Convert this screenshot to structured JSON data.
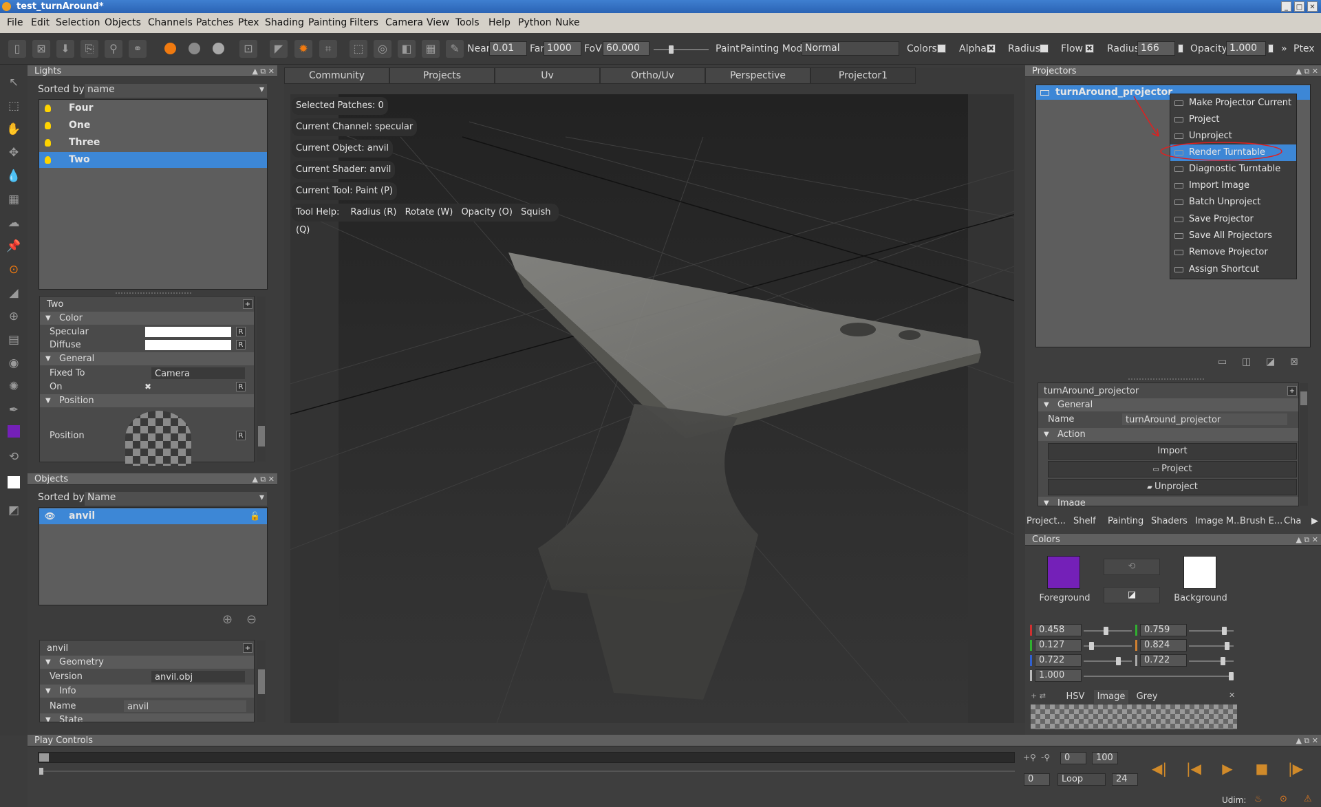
{
  "window": {
    "title": "test_turnAround*"
  },
  "menubar": [
    "File",
    "Edit",
    "Selection",
    "Objects",
    "Channels",
    "Patches",
    "Ptex",
    "Shading",
    "Painting",
    "Filters",
    "Camera",
    "View",
    "Tools",
    "Help",
    "Python",
    "Nuke"
  ],
  "toolbar": {
    "near_label": "Near",
    "near_value": "0.01",
    "far_label": "Far",
    "far_value": "1000",
    "fov_label": "FoV",
    "fov_value": "60.000",
    "paint_label": "Paint",
    "painting_mode_label": "Painting Mode",
    "painting_mode_value": "Normal",
    "colors_label": "Colors",
    "alpha_label": "Alpha",
    "radius_label": "Radius",
    "flow_label": "Flow",
    "radius2_label": "Radius",
    "radius2_value": "166",
    "opacity_label": "Opacity",
    "opacity_value": "1.000",
    "ptex_label": "Ptex"
  },
  "lights": {
    "panel_title": "Lights",
    "sorted_by_label": "Sorted by",
    "sorted_by_value": "name",
    "items": [
      "Four",
      "One",
      "Three",
      "Two"
    ],
    "selected": "Two",
    "props": {
      "title": "Two",
      "color_section": "Color",
      "specular_label": "Specular",
      "diffuse_label": "Diffuse",
      "general_section": "General",
      "fixed_to_label": "Fixed To",
      "fixed_to_value": "Camera",
      "on_label": "On",
      "position_section": "Position",
      "position_label": "Position",
      "reset": "R"
    }
  },
  "objects": {
    "panel_title": "Objects",
    "sorted_by_label": "Sorted by",
    "sorted_by_value": "Name",
    "items": [
      "anvil"
    ],
    "props": {
      "title": "anvil",
      "geometry_section": "Geometry",
      "version_label": "Version",
      "version_value": "anvil.obj",
      "info_section": "Info",
      "name_label": "Name",
      "name_value": "anvil",
      "state_section": "State"
    }
  },
  "viewport": {
    "tabs": [
      "Community",
      "Projects",
      "Uv",
      "Ortho/Uv",
      "Perspective",
      "Projector1"
    ],
    "active_tab": "Projector1",
    "info": [
      "Selected Patches: 0",
      "Current Channel: specular",
      "Current Object: anvil",
      "Current Shader: anvil",
      "Current Tool: Paint (P)"
    ],
    "tool_help": {
      "label": "Tool Help:",
      "items": [
        "Radius (R)",
        "Rotate (W)",
        "Opacity (O)",
        "Squish (Q)"
      ]
    }
  },
  "projectors": {
    "panel_title": "Projectors",
    "item": "turnAround_projector",
    "context_menu": [
      "Make Projector Current",
      "Project",
      "Unproject",
      "Render Turntable",
      "Diagnostic Turntable",
      "Import Image",
      "Batch Unproject",
      "Save Projector",
      "Save All Projectors",
      "Remove Projector",
      "Assign Shortcut"
    ],
    "highlighted": "Render Turntable",
    "props": {
      "title": "turnAround_projector",
      "general_section": "General",
      "name_label": "Name",
      "name_value": "turnAround_projector",
      "action_section": "Action",
      "import_btn": "Import",
      "project_btn": "Project",
      "unproject_btn": "Unproject",
      "image_section": "Image"
    }
  },
  "bottom_tabs": [
    "Project...",
    "Shelf",
    "Painting",
    "Shaders",
    "Image M...",
    "Brush E...",
    "Cha"
  ],
  "colors": {
    "panel_title": "Colors",
    "foreground_label": "Foreground",
    "background_label": "Background",
    "foreground_hex": "#7420b8",
    "background_hex": "#ffffff",
    "left_values": [
      "0.458",
      "0.127",
      "0.722",
      "1.000"
    ],
    "right_values": [
      "0.759",
      "0.824",
      "0.722"
    ],
    "tabs": [
      "HSV",
      "Image",
      "Grey"
    ]
  },
  "play_controls": {
    "panel_title": "Play Controls",
    "range_start": "0",
    "range_end": "100",
    "frame": "0",
    "loop_mode": "Loop",
    "fps": "24",
    "udim_label": "Udim:"
  }
}
